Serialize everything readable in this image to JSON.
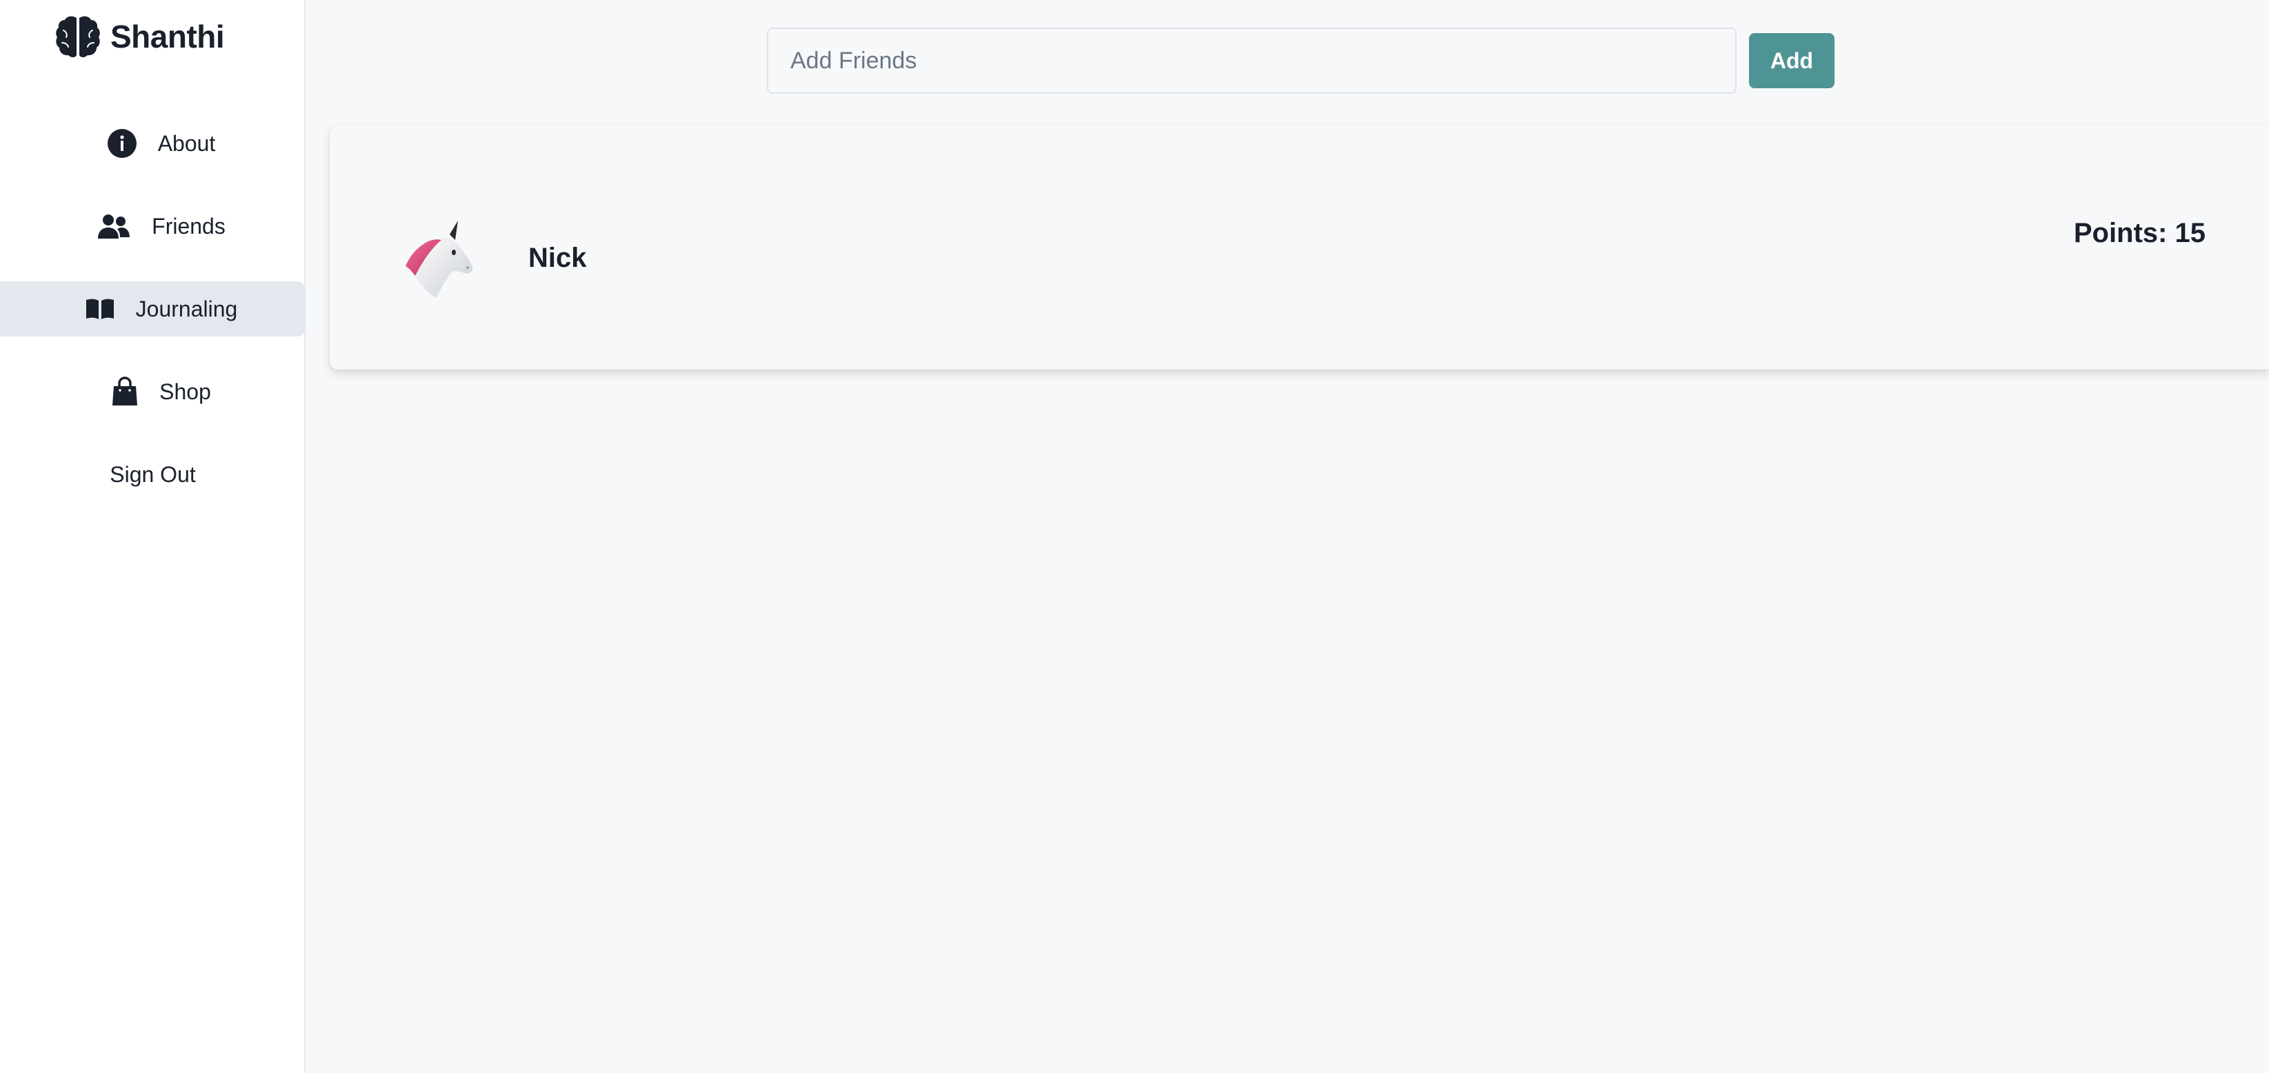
{
  "app": {
    "brand_name": "Shanthi",
    "brand_icon": "brain-icon"
  },
  "sidebar": {
    "items": [
      {
        "label": "About",
        "icon": "info-circle-icon",
        "active": false
      },
      {
        "label": "Friends",
        "icon": "users-icon",
        "active": false
      },
      {
        "label": "Journaling",
        "icon": "book-open-icon",
        "active": true
      },
      {
        "label": "Shop",
        "icon": "shopping-bag-icon",
        "active": false
      },
      {
        "label": "Sign Out",
        "icon": "",
        "active": false
      }
    ],
    "active_bg": "#e3e8ef"
  },
  "add_friends": {
    "placeholder": "Add Friends",
    "value": "",
    "button_label": "Add",
    "button_color": "#4f9494"
  },
  "friends": [
    {
      "name": "Nick",
      "avatar": "unicorn-icon",
      "points_label": "Points:",
      "points": 15
    }
  ]
}
